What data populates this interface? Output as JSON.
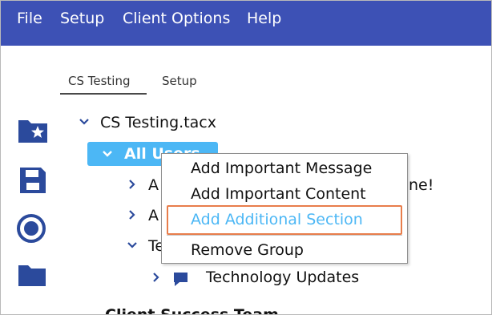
{
  "menubar": {
    "items": [
      "File",
      "Setup",
      "Client Options",
      "Help"
    ]
  },
  "tabs": [
    {
      "label": "CS Testing",
      "active": true
    },
    {
      "label": "Setup",
      "active": false
    }
  ],
  "sidebar": {
    "icons": [
      "folder-star-icon",
      "save-icon",
      "radio-target-icon",
      "folder-icon"
    ]
  },
  "tree": {
    "root": "CS Testing.tacx",
    "selected_group": "All Users",
    "child_prefixes": [
      "A",
      "A",
      "Te"
    ],
    "hidden_suffix": "ne!",
    "leaf": "Technology Updates",
    "next_group_partial": "Client Success Team"
  },
  "context_menu": {
    "items": [
      "Add Important Message",
      "Add Important Content",
      "Add Additional Section",
      "Remove Group"
    ],
    "highlighted_index": 2
  },
  "colors": {
    "menubar_bg": "#3d51b5",
    "accent_blue": "#4cb7f5",
    "icon_navy": "#2b4a9c",
    "highlight_border": "#e87d4b"
  }
}
